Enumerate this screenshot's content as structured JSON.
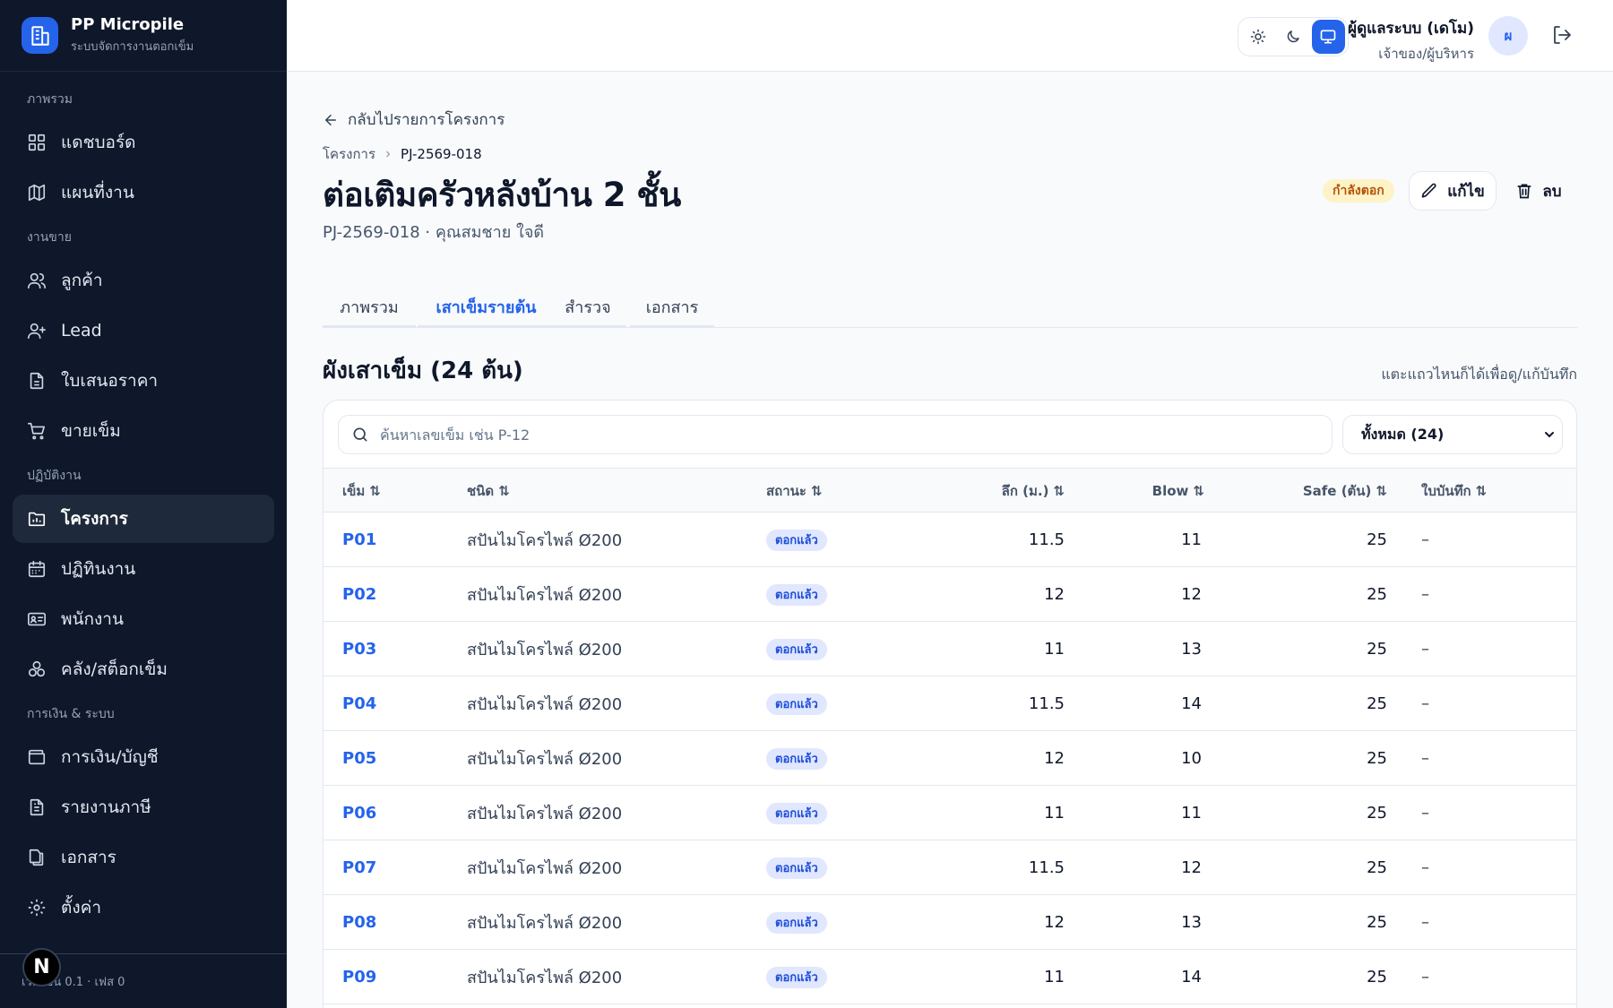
{
  "brand": {
    "name": "PP Micropile",
    "subtitle": "ระบบจัดการงานตอกเข็ม"
  },
  "sidebar": {
    "groups": [
      {
        "label": "ภาพรวม",
        "items": [
          {
            "label": "แดชบอร์ด",
            "icon": "dashboard-icon"
          },
          {
            "label": "แผนที่งาน",
            "icon": "map-icon"
          }
        ]
      },
      {
        "label": "งานขาย",
        "items": [
          {
            "label": "ลูกค้า",
            "icon": "users-icon"
          },
          {
            "label": "Lead",
            "icon": "user-plus-icon"
          },
          {
            "label": "ใบเสนอราคา",
            "icon": "document-icon"
          },
          {
            "label": "ขายเข็ม",
            "icon": "cart-icon"
          }
        ]
      },
      {
        "label": "ปฏิบัติงาน",
        "items": [
          {
            "label": "โครงการ",
            "icon": "folder-chart-icon",
            "active": true
          },
          {
            "label": "ปฏิทินงาน",
            "icon": "calendar-icon"
          },
          {
            "label": "พนักงาน",
            "icon": "id-card-icon"
          },
          {
            "label": "คลัง/สต็อกเข็ม",
            "icon": "boxes-icon"
          }
        ]
      },
      {
        "label": "การเงิน & ระบบ",
        "items": [
          {
            "label": "การเงิน/บัญชี",
            "icon": "wallet-icon"
          },
          {
            "label": "รายงานภาษี",
            "icon": "receipt-icon"
          },
          {
            "label": "เอกสาร",
            "icon": "files-icon"
          },
          {
            "label": "ตั้งค่า",
            "icon": "gear-icon"
          }
        ]
      }
    ],
    "footer": "เวอร์ชัน 0.1 · เฟส 0"
  },
  "topbar": {
    "theme_modes": [
      "light",
      "dark",
      "system"
    ],
    "active_theme": "system",
    "user_name": "ผู้ดูแลระบบ (เดโม)",
    "user_role": "เจ้าของ/ผู้บริหาร",
    "avatar_initial": "ผ"
  },
  "page": {
    "back_label": "กลับไปรายการโครงการ",
    "breadcrumb": [
      "โครงการ",
      "PJ-2569-018"
    ],
    "title": "ต่อเติมครัวหลังบ้าน 2 ชั้น",
    "subtitle": "PJ-2569-018 · คุณสมชาย ใจดี",
    "status": "กำลังตอก",
    "edit_label": "แก้ไข",
    "delete_label": "ลบ"
  },
  "tabs": [
    {
      "label": "ภาพรวม"
    },
    {
      "label": "เสาเข็มรายต้น",
      "active": true
    },
    {
      "label": "สำรวจ"
    },
    {
      "label": "เอกสาร"
    }
  ],
  "section": {
    "title": "ผังเสาเข็ม (24 ต้น)",
    "hint": "แตะแถวไหนก็ได้เพื่อดู/แก้บันทึก"
  },
  "search": {
    "placeholder": "ค้นหาเลขเข็ม เช่น P-12",
    "value": ""
  },
  "filter": {
    "selected": "ทั้งหมด (24)"
  },
  "table": {
    "columns": [
      "เข็ม",
      "ชนิด",
      "สถานะ",
      "ลึก (ม.)",
      "Blow",
      "Safe (ตัน)",
      "ใบบันทึก"
    ],
    "rows": [
      {
        "pile": "P01",
        "type": "สปันไมโครไพล์ Ø200",
        "status": "ตอกแล้ว",
        "depth": "11.5",
        "blow": "11",
        "safe": "25",
        "note": "–"
      },
      {
        "pile": "P02",
        "type": "สปันไมโครไพล์ Ø200",
        "status": "ตอกแล้ว",
        "depth": "12",
        "blow": "12",
        "safe": "25",
        "note": "–"
      },
      {
        "pile": "P03",
        "type": "สปันไมโครไพล์ Ø200",
        "status": "ตอกแล้ว",
        "depth": "11",
        "blow": "13",
        "safe": "25",
        "note": "–"
      },
      {
        "pile": "P04",
        "type": "สปันไมโครไพล์ Ø200",
        "status": "ตอกแล้ว",
        "depth": "11.5",
        "blow": "14",
        "safe": "25",
        "note": "–"
      },
      {
        "pile": "P05",
        "type": "สปันไมโครไพล์ Ø200",
        "status": "ตอกแล้ว",
        "depth": "12",
        "blow": "10",
        "safe": "25",
        "note": "–"
      },
      {
        "pile": "P06",
        "type": "สปันไมโครไพล์ Ø200",
        "status": "ตอกแล้ว",
        "depth": "11",
        "blow": "11",
        "safe": "25",
        "note": "–"
      },
      {
        "pile": "P07",
        "type": "สปันไมโครไพล์ Ø200",
        "status": "ตอกแล้ว",
        "depth": "11.5",
        "blow": "12",
        "safe": "25",
        "note": "–"
      },
      {
        "pile": "P08",
        "type": "สปันไมโครไพล์ Ø200",
        "status": "ตอกแล้ว",
        "depth": "12",
        "blow": "13",
        "safe": "25",
        "note": "–"
      },
      {
        "pile": "P09",
        "type": "สปันไมโครไพล์ Ø200",
        "status": "ตอกแล้ว",
        "depth": "11",
        "blow": "14",
        "safe": "25",
        "note": "–"
      }
    ]
  },
  "colors": {
    "sidebar_bg": "#0f172a",
    "accent": "#2563eb",
    "status_pill_bg": "#fef3c7",
    "status_pill_text": "#b45309"
  }
}
